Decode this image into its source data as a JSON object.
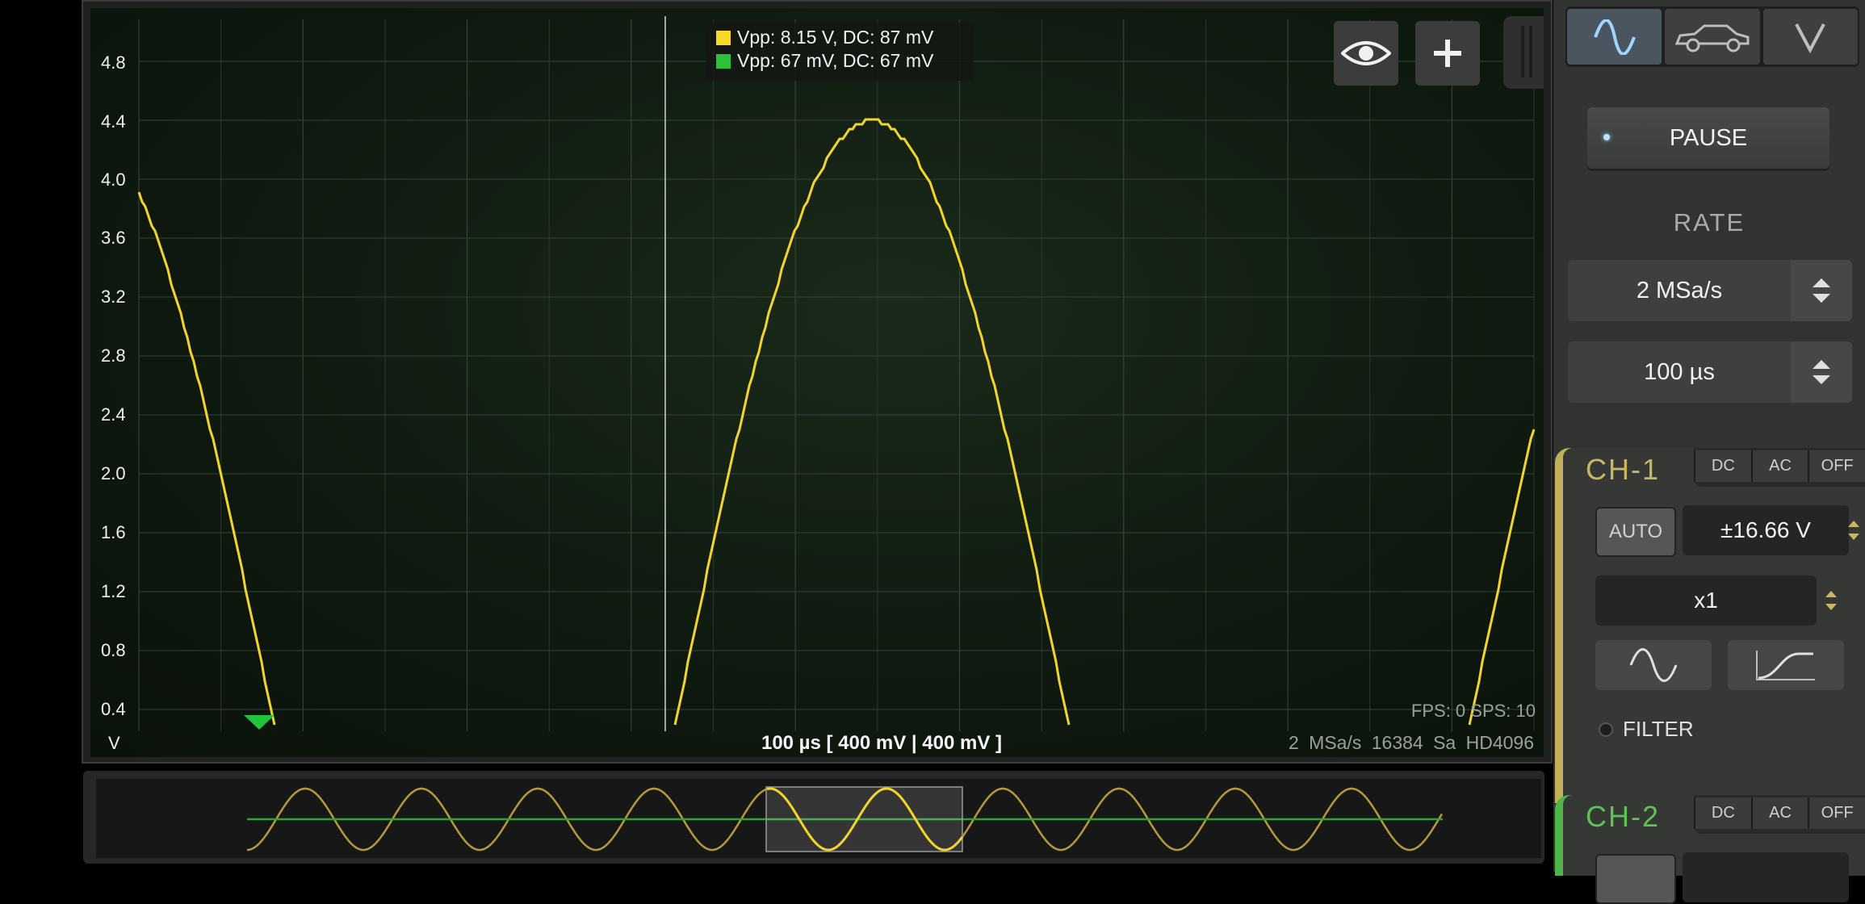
{
  "scope": {
    "y_unit": "V",
    "y_ticks": [
      "4.8",
      "4.4",
      "4.0",
      "3.6",
      "3.2",
      "2.8",
      "2.4",
      "2.0",
      "1.6",
      "1.2",
      "0.8",
      "0.4"
    ],
    "legend": [
      {
        "text": "Vpp: 8.15 V, DC: 87 mV",
        "color": "#f7d92a"
      },
      {
        "text": "Vpp: 67 mV, DC: 67 mV",
        "color": "#2bc23a"
      }
    ],
    "fps_text": "FPS: 0  SPS: 10",
    "timebase_text": "100 µs  [ 400 mV | 400 mV ]",
    "acq_text": "2 MSa/s   16384 Sa   HD4096",
    "trace_color": "#f2d42a",
    "trigger_color": "#21c23c",
    "icons": {
      "eye": "eye-icon",
      "plus": "plus-icon"
    }
  },
  "overview": {
    "trace1_color": "#b49a3a",
    "trace2_color": "#2da33a"
  },
  "panel": {
    "modes": [
      "sine-wave-icon",
      "car-icon",
      "voltmeter-icon"
    ],
    "pause_label": "PAUSE",
    "rate_label": "RATE",
    "rate_value": "2 MSa/s",
    "time_value": "100 µs",
    "ch1": {
      "title": "CH-1",
      "color": "#c9b760",
      "coupling": [
        "DC",
        "AC",
        "OFF"
      ],
      "auto_label": "AUTO",
      "range": "±16.66 V",
      "probe": "x1",
      "filter_label": "FILTER"
    },
    "ch2": {
      "title": "CH-2",
      "color": "#5cc253",
      "coupling": [
        "DC",
        "AC",
        "OFF"
      ]
    }
  }
}
